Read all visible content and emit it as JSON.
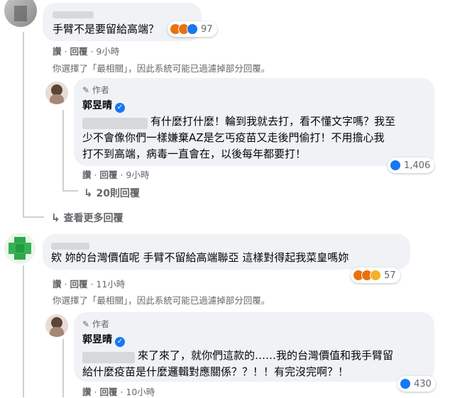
{
  "thread1": {
    "comment": {
      "text": "手臂不是要留給高端？",
      "reaction_count": "97",
      "actions": {
        "like": "讚",
        "reply": "回覆",
        "time": "9小時"
      },
      "filter_note": "你選擇了「最相關」，因此系統可能已過濾掉部分回覆。"
    },
    "reply": {
      "badge": "作者",
      "author": "郭昱晴",
      "lines": [
        "有什麼打什麼！輪到我就去打，看不懂文字嗎？我至",
        "少不會像你們一樣嫌棄AZ是乞丐疫苗又走後門偷打！不用擔心我",
        "打不到高端，病毒一直會在，以後每年都要打！"
      ],
      "reaction_count": "1,406",
      "actions": {
        "like": "讚",
        "reply": "回覆",
        "time": "9小時"
      },
      "more_replies": "20則回覆"
    },
    "view_more": "查看更多回覆"
  },
  "thread2": {
    "comment": {
      "text": "欸 妳的台灣價值呢 手臂不留給高端聯亞 這樣對得起我菜皇嗎妳",
      "reaction_count": "57",
      "actions": {
        "like": "讚",
        "reply": "回覆",
        "time": "11小時"
      },
      "filter_note": "你選擇了「最相關」，因此系統可能已過濾掉部分回覆。"
    },
    "reply": {
      "badge": "作者",
      "author": "郭昱晴",
      "lines": [
        "來了來了，就你們這款的……我的台灣價值和我手臂留",
        "給什麼疫苗是什麼邏輯對應關係？？！！有完沒完啊？！"
      ],
      "reaction_count": "430",
      "actions": {
        "like": "讚",
        "reply": "回覆",
        "time": "10小時"
      }
    }
  },
  "colors": {
    "bubble": "#f0f2f5",
    "meta_text": "#65676b",
    "like_blue": "#1877f2",
    "angry_orange": "#e9710f",
    "haha_yellow": "#f7b125"
  },
  "icons": {
    "like": "thumbs-up-icon",
    "angry": "angry-face-icon",
    "haha": "laughing-face-icon",
    "verified": "verified-badge-icon",
    "author": "pencil-icon",
    "reply_arrow": "reply-arrow-icon"
  }
}
